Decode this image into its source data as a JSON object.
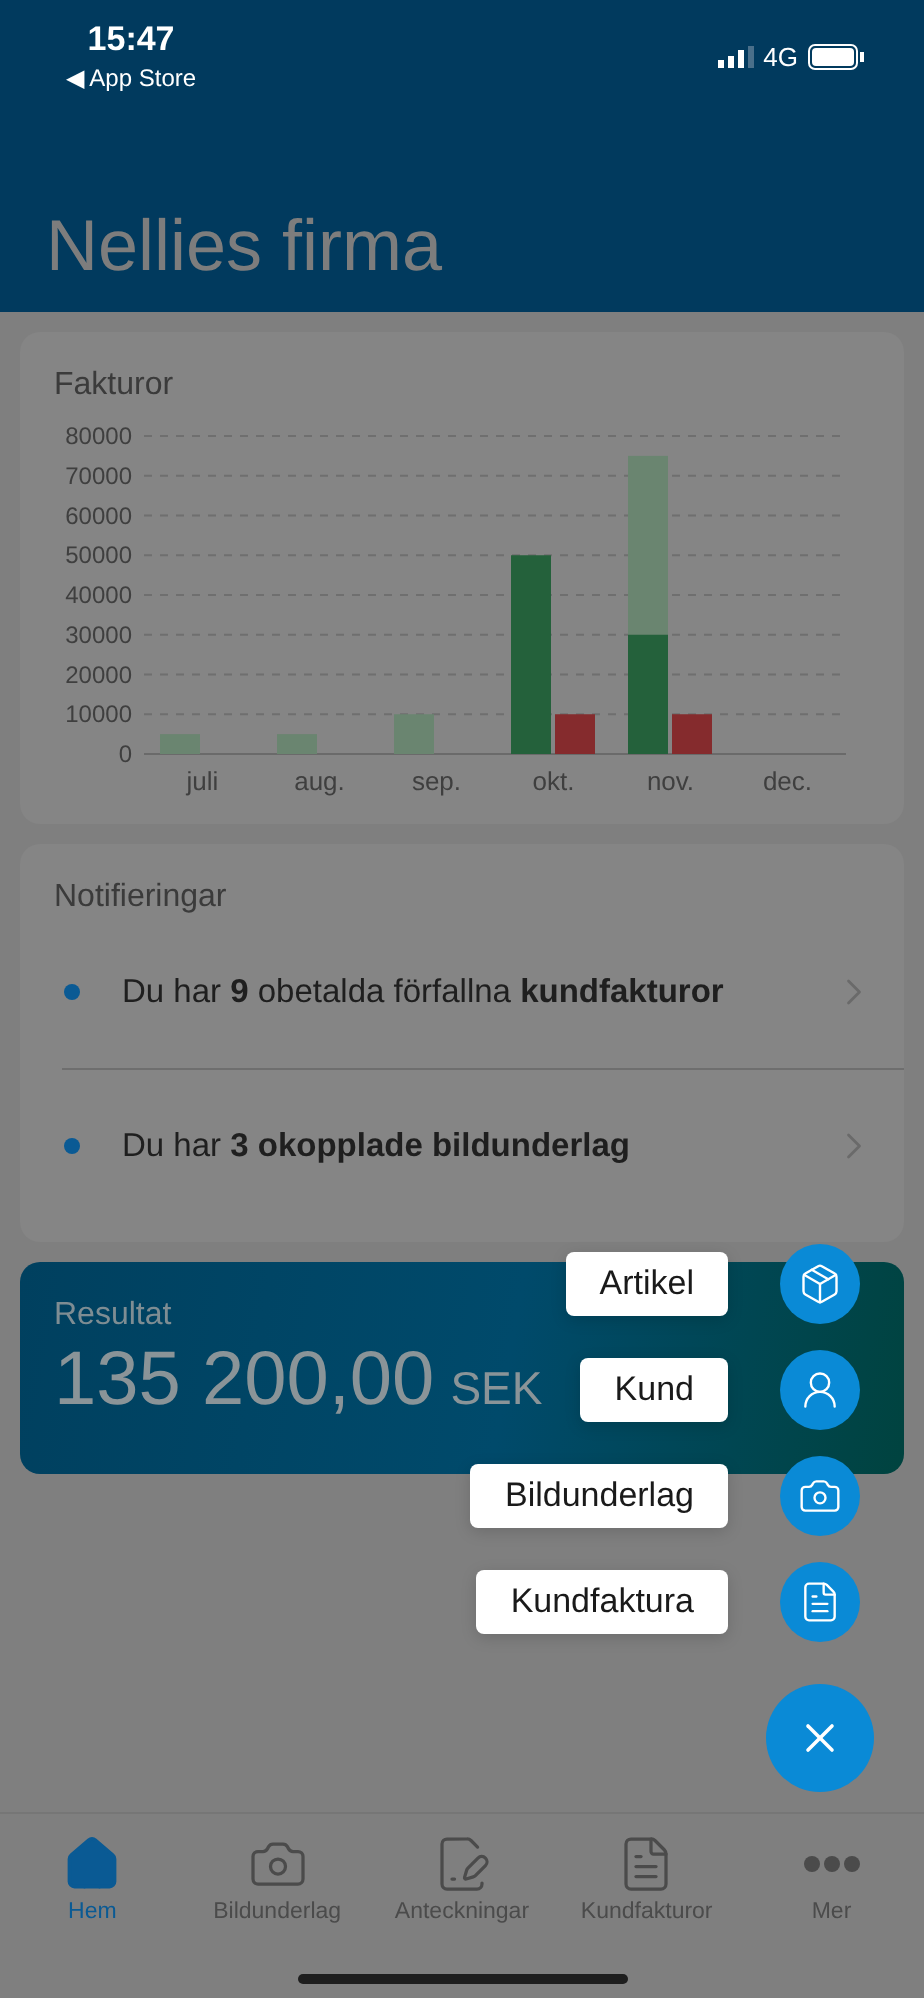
{
  "status_bar": {
    "time": "15:47",
    "back_label": "◀ App Store",
    "network": "4G"
  },
  "header": {
    "title": "Nellies firma"
  },
  "invoices_card": {
    "chart_data": {
      "type": "bar",
      "title": "Fakturor",
      "categories": [
        "juli",
        "aug.",
        "sep.",
        "okt.",
        "nov.",
        "dec."
      ],
      "stacked": false,
      "grid": true,
      "ylim": [
        0,
        80000
      ],
      "yticks": [
        0,
        10000,
        20000,
        30000,
        40000,
        50000,
        60000,
        70000,
        80000
      ],
      "series": [
        {
          "color": "#6a8570",
          "values": [
            5000,
            5000,
            10000,
            0,
            75000,
            0
          ]
        },
        {
          "color": "#24613b",
          "values": [
            0,
            0,
            0,
            50000,
            30000,
            0
          ]
        },
        {
          "color": "#852b2d",
          "values": [
            0,
            0,
            0,
            10000,
            10000,
            0
          ]
        }
      ]
    }
  },
  "notifications": {
    "title": "Notifieringar",
    "items": [
      {
        "text": "Du har **9** obetalda förfallna **kundfakturor**"
      },
      {
        "text": "Du har **3 okopplade bildunderlag**"
      }
    ]
  },
  "result": {
    "label": "Resultat",
    "amount": "135 200,00",
    "currency": "SEK"
  },
  "fab_menu": {
    "items": [
      {
        "label": "Artikel",
        "kind": "box"
      },
      {
        "label": "Kund",
        "kind": "person"
      },
      {
        "label": "Bildunderlag",
        "kind": "camera"
      },
      {
        "label": "Kundfaktura",
        "kind": "document"
      }
    ]
  },
  "tab_bar": {
    "items": [
      {
        "label": "Hem",
        "kind": "home",
        "selected": true
      },
      {
        "label": "Bildunderlag",
        "kind": "camera",
        "selected": false
      },
      {
        "label": "Anteckningar",
        "kind": "notes",
        "selected": false
      },
      {
        "label": "Kundfakturor",
        "kind": "document",
        "selected": false
      },
      {
        "label": "Mer",
        "kind": "more",
        "selected": false
      }
    ]
  }
}
